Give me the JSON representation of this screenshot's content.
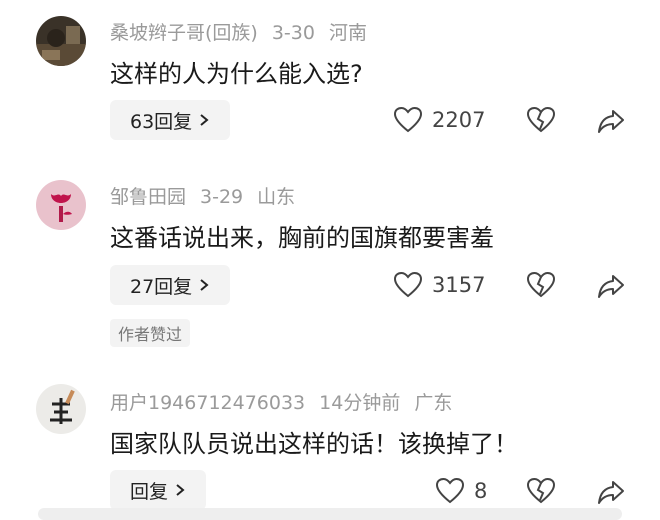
{
  "comments": [
    {
      "username": "桑坡辫子哥(回族)",
      "date": "3-30",
      "location": "河南",
      "text": "这样的人为什么能入选?",
      "reply_label": "63回复",
      "likes": "2207",
      "avatar_icon": "dark-photo-avatar"
    },
    {
      "username": "邹鲁田园",
      "date": "3-29",
      "location": "山东",
      "text": "这番话说出来，胸前的国旗都要害羞",
      "reply_label": "27回复",
      "likes": "3157",
      "badge": "作者赞过",
      "avatar_icon": "flower-avatar"
    },
    {
      "username": "用户1946712476033",
      "date": "14分钟前",
      "location": "广东",
      "text": "国家队队员说出这样的话！该换掉了！",
      "reply_label": "回复",
      "likes": "8",
      "avatar_icon": "calligraphy-avatar"
    }
  ],
  "icons": {
    "like": "heart-icon",
    "dislike": "broken-heart-icon",
    "share": "share-arrow-icon",
    "chevron": "chevron-right-icon"
  },
  "colors": {
    "meta_text": "#9a9a9a",
    "body_text": "#1a1a1a",
    "pill_bg": "#f3f3f3"
  }
}
